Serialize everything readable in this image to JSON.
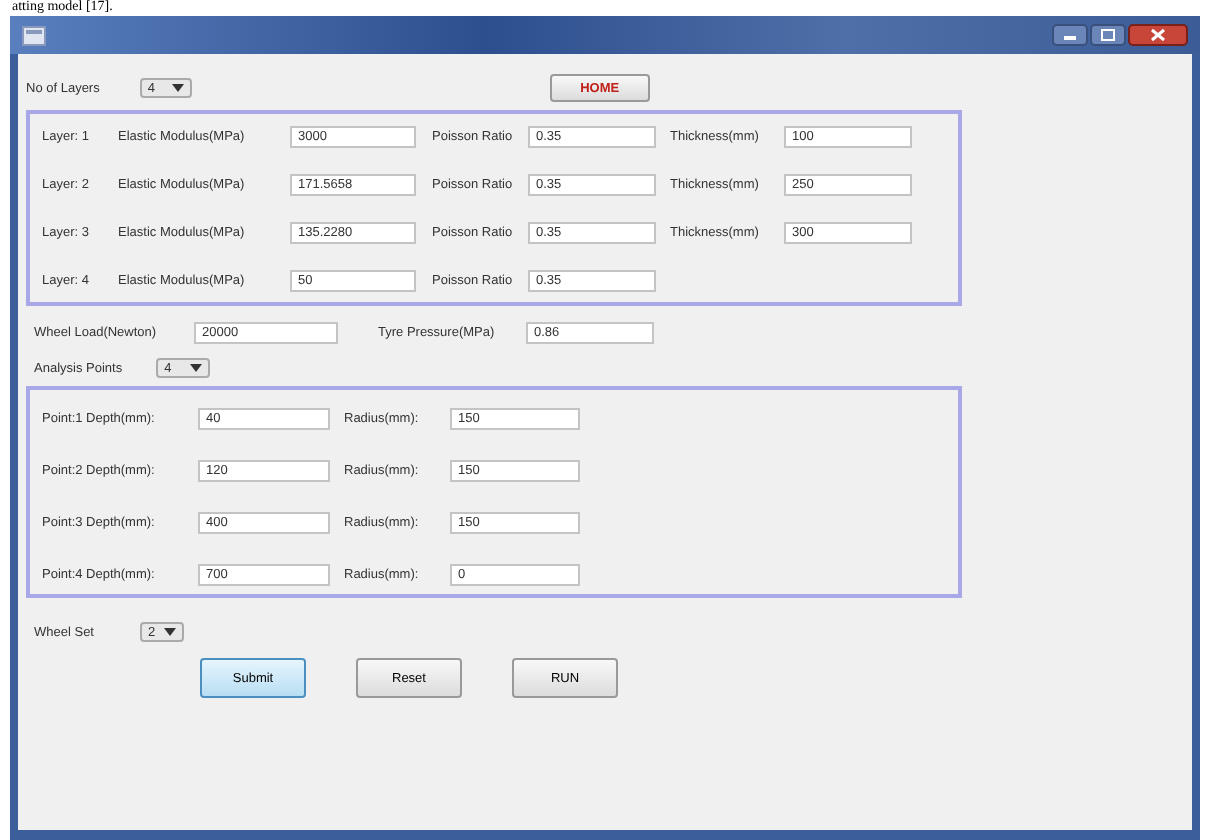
{
  "caption": "atting model [17].",
  "layer_count": {
    "label": "No of Layers",
    "value": "4"
  },
  "home_button": "HOME",
  "layers": [
    {
      "label": "Layer: 1",
      "modulus_label": "Elastic Modulus(MPa)",
      "modulus": "3000",
      "poisson_label": "Poisson Ratio",
      "poisson": "0.35",
      "thickness_label": "Thickness(mm)",
      "thickness": "100"
    },
    {
      "label": "Layer: 2",
      "modulus_label": "Elastic Modulus(MPa)",
      "modulus": "171.5658",
      "poisson_label": "Poisson Ratio",
      "poisson": "0.35",
      "thickness_label": "Thickness(mm)",
      "thickness": "250"
    },
    {
      "label": "Layer: 3",
      "modulus_label": "Elastic Modulus(MPa)",
      "modulus": "135.2280",
      "poisson_label": "Poisson Ratio",
      "poisson": "0.35",
      "thickness_label": "Thickness(mm)",
      "thickness": "300"
    },
    {
      "label": "Layer: 4",
      "modulus_label": "Elastic Modulus(MPa)",
      "modulus": "50",
      "poisson_label": "Poisson Ratio",
      "poisson": "0.35"
    }
  ],
  "wheel_load": {
    "label": "Wheel Load(Newton)",
    "value": "20000"
  },
  "tyre_pressure": {
    "label": "Tyre Pressure(MPa)",
    "value": "0.86"
  },
  "analysis_points": {
    "label": "Analysis Points",
    "value": "4"
  },
  "points": [
    {
      "label": "Point:1 Depth(mm):",
      "depth": "40",
      "radius_label": "Radius(mm):",
      "radius": "150"
    },
    {
      "label": "Point:2 Depth(mm):",
      "depth": "120",
      "radius_label": "Radius(mm):",
      "radius": "150"
    },
    {
      "label": "Point:3 Depth(mm):",
      "depth": "400",
      "radius_label": "Radius(mm):",
      "radius": "150"
    },
    {
      "label": "Point:4 Depth(mm):",
      "depth": "700",
      "radius_label": "Radius(mm):",
      "radius": "0"
    }
  ],
  "wheel_set": {
    "label": "Wheel Set",
    "value": "2"
  },
  "buttons": [
    {
      "label": "Submit",
      "focused": true
    },
    {
      "label": "Reset",
      "focused": false
    },
    {
      "label": "RUN",
      "focused": false
    }
  ]
}
